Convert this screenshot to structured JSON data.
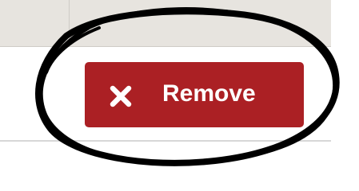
{
  "table": {
    "header_color": "#e7e4df",
    "border_color": "#cfccc6"
  },
  "remove_button": {
    "label": "Remove",
    "icon": "x-icon",
    "background": "#ab2024",
    "text_color": "#ffffff"
  },
  "annotation": {
    "shape": "hand-drawn-circle",
    "color": "#000000"
  }
}
